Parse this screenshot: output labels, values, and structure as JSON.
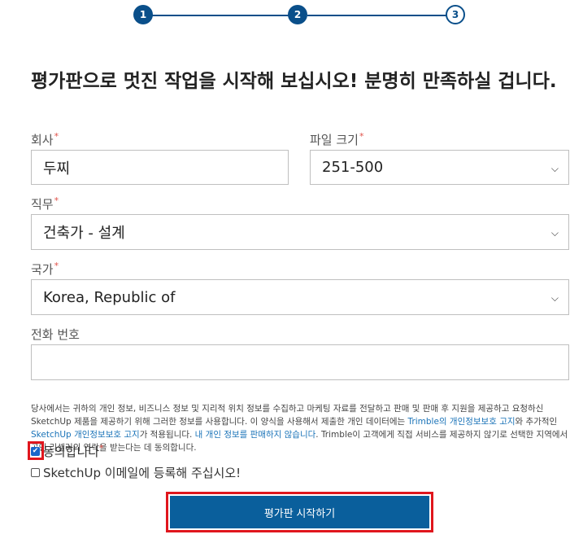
{
  "stepper": {
    "steps": [
      "1",
      "2",
      "3"
    ]
  },
  "title": "평가판으로 멋진 작업을 시작해 보십시오! 분명히 만족하실 겁니다.",
  "company": {
    "label": "회사",
    "value": "두찌"
  },
  "file_size": {
    "label": "파일 크기",
    "value": "251-500"
  },
  "job": {
    "label": "직무",
    "value": "건축가 - 설계"
  },
  "country": {
    "label": "국가",
    "value": "Korea, Republic of"
  },
  "phone": {
    "label": "전화 번호",
    "value": ""
  },
  "required_marker": "*",
  "privacy": {
    "part1": "당사에서는 귀하의 개인 정보, 비즈니스 정보 및 지리적 위치 정보를 수집하고 마케팅 자료를 전달하고 판매 및 판매 후 지원을 제공하고 요청하신 SketchUp 제품을 제공하기 위해 그러한 정보를 사용합니다. 이 양식을 사용해서 제출한 개인 데이터에는 ",
    "link1": "Trimble의 개인정보보호 고지",
    "part2": "와 추가적인 ",
    "link2": "SketchUp 개인정보보호 고지",
    "part3": "가 적용됩니다. ",
    "link3": "내 개인 정보를 판매하지 않습니다",
    "part4": ". Trimble이 고객에게 직접 서비스를 제공하지 않기로 선택한 지역에서 공인 리셀러의 연락을 받는다는 데 동의합니다."
  },
  "agree": {
    "label": "동의합니다",
    "checked": true
  },
  "newsletter": {
    "label": "SketchUp 이메일에 등록해 주십시오!",
    "checked": false
  },
  "submit_label": "평가판 시작하기",
  "colors": {
    "accent": "#0a5f9c",
    "step": "#0a4f8a",
    "highlight": "#e0161d",
    "required": "#e0524a"
  }
}
